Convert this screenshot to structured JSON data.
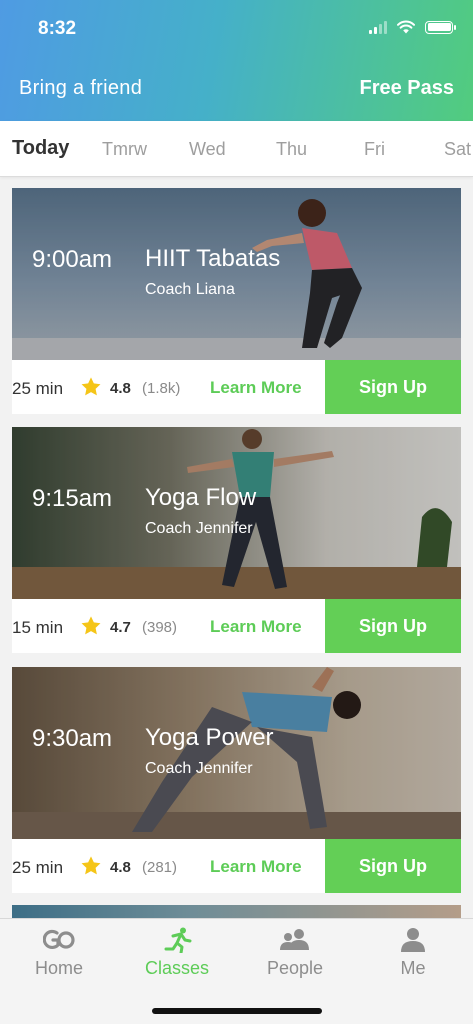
{
  "status_bar": {
    "time": "8:32"
  },
  "promo": {
    "text": "Bring a friend",
    "link": "Free Pass"
  },
  "days": [
    {
      "label": "Today",
      "active": true
    },
    {
      "label": "Tmrw"
    },
    {
      "label": "Wed"
    },
    {
      "label": "Thu"
    },
    {
      "label": "Fri"
    },
    {
      "label": "Sat"
    }
  ],
  "classes": [
    {
      "time": "9:00am",
      "title": "HIIT Tabatas",
      "coach": "Coach Liana",
      "duration": "25 min",
      "rating": "4.8",
      "count": "(1.8k)",
      "learn_label": "Learn More",
      "signup_label": "Sign Up"
    },
    {
      "time": "9:15am",
      "title": "Yoga Flow",
      "coach": "Coach Jennifer",
      "duration": "15 min",
      "rating": "4.7",
      "count": "(398)",
      "learn_label": "Learn More",
      "signup_label": "Sign Up"
    },
    {
      "time": "9:30am",
      "title": "Yoga Power",
      "coach": "Coach Jennifer",
      "duration": "25 min",
      "rating": "4.8",
      "count": "(281)",
      "learn_label": "Learn More",
      "signup_label": "Sign Up"
    }
  ],
  "tabs": [
    {
      "label": "Home",
      "icon": "go-logo-icon"
    },
    {
      "label": "Classes",
      "icon": "running-person-icon",
      "active": true
    },
    {
      "label": "People",
      "icon": "people-icon"
    },
    {
      "label": "Me",
      "icon": "person-icon"
    }
  ],
  "colors": {
    "accent_green": "#63cf56",
    "gradient_start": "#4f9be3",
    "gradient_end": "#52cc7e",
    "star": "#f5c518"
  }
}
